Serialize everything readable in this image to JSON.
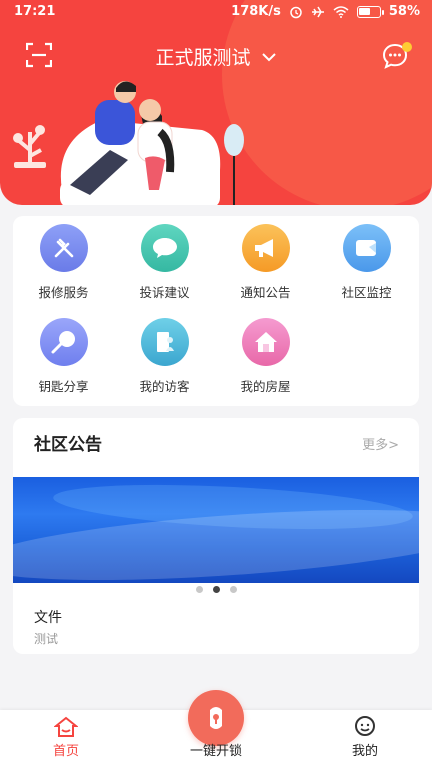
{
  "status_bar": {
    "time": "17:21",
    "network_speed": "178K/s",
    "battery": "58%",
    "battery_level": 0.58
  },
  "header": {
    "title": "正式服测试",
    "scan_icon": "scan-icon",
    "message_icon": "message-icon",
    "colors": {
      "primary": "#f5443f",
      "secondary": "#f86a4f",
      "badge": "#ffcc33"
    }
  },
  "quick_actions": [
    {
      "label": "报修服务",
      "icon": "wrench-icon",
      "color": "#7a8df2"
    },
    {
      "label": "投诉建议",
      "icon": "chat-bubble-icon",
      "color": "#3fc7b0"
    },
    {
      "label": "通知公告",
      "icon": "megaphone-icon",
      "color": "#f8a83a"
    },
    {
      "label": "社区监控",
      "icon": "camera-icon",
      "color": "#5aa8f0"
    },
    {
      "label": "钥匙分享",
      "icon": "key-share-icon",
      "color": "#7c8ef6"
    },
    {
      "label": "我的访客",
      "icon": "visitor-icon",
      "color": "#4fb7d8"
    },
    {
      "label": "我的房屋",
      "icon": "house-icon",
      "color": "#f070b0"
    }
  ],
  "notice": {
    "title": "社区公告",
    "more": "更多>",
    "item_title": "文件",
    "item_subtitle": "测试",
    "carousel_active": 1
  },
  "nav": {
    "home": "首页",
    "unlock": "一键开锁",
    "mine": "我的",
    "active_color": "#f5443f"
  }
}
